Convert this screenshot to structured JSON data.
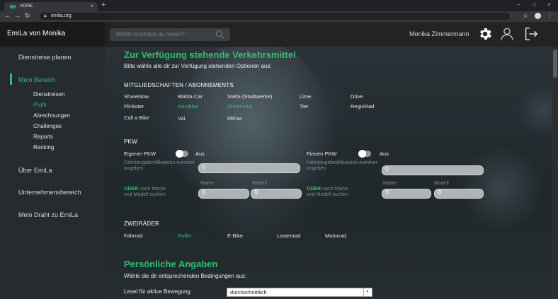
{
  "browser": {
    "tab_title": "HOME",
    "tab_close": "×",
    "new_tab": "+",
    "url": "emila.org",
    "min": "–",
    "max": "□",
    "close": "×"
  },
  "header": {
    "brand": "EmiLa von Monika",
    "search_placeholder": "Wohin möchtest du reisen?",
    "user_name": "Monika Zimmermann"
  },
  "sidebar": {
    "items": [
      {
        "label": "Dienstreise planen"
      },
      {
        "label": "Mein Bereich"
      },
      {
        "label": "Über EmiLa"
      },
      {
        "label": "Unternehmensbereich"
      },
      {
        "label": "Mein Draht zu EmiLa"
      }
    ],
    "sub_items": [
      {
        "label": "Dienstreisen"
      },
      {
        "label": "Profil"
      },
      {
        "label": "Abrechnungen"
      },
      {
        "label": "Challenges"
      },
      {
        "label": "Reports"
      },
      {
        "label": "Ranking"
      }
    ]
  },
  "main": {
    "title": "Zur Verfügung stehende Verkehrsmittel",
    "subtitle": "Bitte wähle alle dir zur Verfügung stehenden Optionen aus:",
    "memberships_heading": "MITGLIEDSCHAFTEN / ABONNEMENTS",
    "memberships": [
      {
        "label": "ShareNow"
      },
      {
        "label": "Blabla Car"
      },
      {
        "label": "Stella (Stadtwerke)"
      },
      {
        "label": "Lime"
      },
      {
        "label": "Drive"
      },
      {
        "label": "Flinkster"
      },
      {
        "label": "Nextbike"
      },
      {
        "label": "Stadtmobil"
      },
      {
        "label": "Tier"
      },
      {
        "label": "RegioRad"
      },
      {
        "label": "Call a Bike"
      },
      {
        "label": "Voi"
      },
      {
        "label": "MiFaz"
      }
    ],
    "pkw_heading": "PKW",
    "own_car": {
      "label": "Eigener PKW",
      "toggle": "Aus"
    },
    "company_car": {
      "label": "Firmen PKW",
      "toggle": "Aus"
    },
    "plate_hint": "Fahrzeugidentifikations-nummer angeben",
    "or_word": "ODER",
    "or_rest": " nach Marke",
    "or_line2": "und Modell suchen",
    "brand_label": "Marke",
    "model_label": "Modell",
    "search_q": "Q",
    "two_wheel_heading": "ZWEIRÄDER",
    "two_wheelers": [
      {
        "label": "Fahrrad"
      },
      {
        "label": "Roller"
      },
      {
        "label": "E-Bike"
      },
      {
        "label": "Lastenrad"
      },
      {
        "label": "Motorrad"
      }
    ],
    "personal_title": "Persönliche Angaben",
    "personal_subtitle": "Wähle die dir entsprechenden Bedingungen aus:",
    "activity_label": "Level für aktive Bewegung",
    "activity_value": "durchschnittlich"
  },
  "colors": {
    "accent": "#2fbf71",
    "sidebar": "#252b2f",
    "header": "#232323"
  }
}
